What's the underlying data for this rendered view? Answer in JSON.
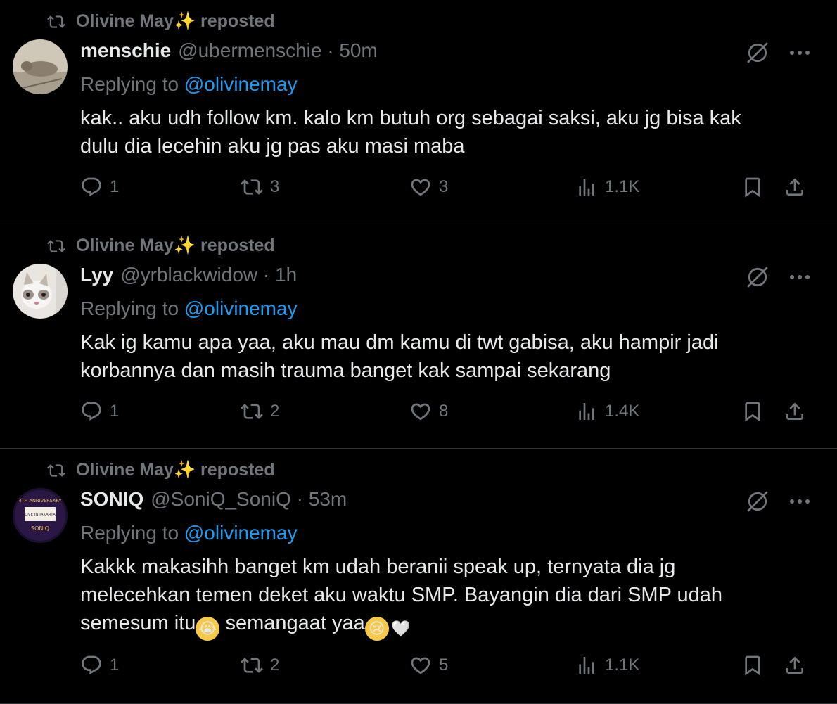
{
  "tweets": [
    {
      "repost_text": "Olivine May✨ reposted",
      "name": "menschie",
      "handle_time": "@ubermenschie · 50m",
      "replying_prefix": "Replying to ",
      "replying_handle": "@olivinemay",
      "text_lines": [
        "kak.. aku udh follow km. kalo km butuh org sebagai saksi, aku jg bisa kak",
        "dulu dia lecehin aku jg pas aku masi maba"
      ],
      "replies": "1",
      "reposts": "3",
      "likes": "3",
      "views": "1.1K"
    },
    {
      "repost_text": "Olivine May✨ reposted",
      "name": "Lyy",
      "handle_time": "@yrblackwidow · 1h",
      "replying_prefix": "Replying to ",
      "replying_handle": "@olivinemay",
      "text_lines": [
        "Kak ig kamu apa yaa, aku mau dm kamu di twt gabisa, aku hampir jadi",
        "korbannya dan masih trauma banget kak sampai sekarang"
      ],
      "replies": "1",
      "reposts": "2",
      "likes": "8",
      "views": "1.4K"
    },
    {
      "repost_text": "Olivine May✨ reposted",
      "name": "SONIQ",
      "handle_time": "@SoniQ_SoniQ · 53m",
      "replying_prefix": "Replying to ",
      "replying_handle": "@olivinemay",
      "text_lines": [
        "Kakkk makasihh banget km udah beranii speak up, ternyata dia jg",
        "melecehkan temen deket aku waktu SMP. Bayangin dia dari SMP udah"
      ],
      "text_line3_a": "semesum itu",
      "text_line3_b": " semangaat yaa",
      "avatar_text": [
        "4TH ANNIVERSARY",
        "LIVE IN JAKARTA",
        "SONIQ"
      ],
      "replies": "1",
      "reposts": "2",
      "likes": "5",
      "views": "1.1K"
    }
  ],
  "icons": {
    "repost": "repost-icon",
    "grok": "grok-icon",
    "more": "more-icon",
    "reply": "reply-icon",
    "retweet": "retweet-icon",
    "like": "heart-icon",
    "views": "views-icon",
    "bookmark": "bookmark-icon",
    "share": "share-icon"
  },
  "colors": {
    "background": "#000000",
    "text": "#e7e9ea",
    "muted": "#71767b",
    "link": "#1d9bf0",
    "divider": "#2f3336"
  }
}
